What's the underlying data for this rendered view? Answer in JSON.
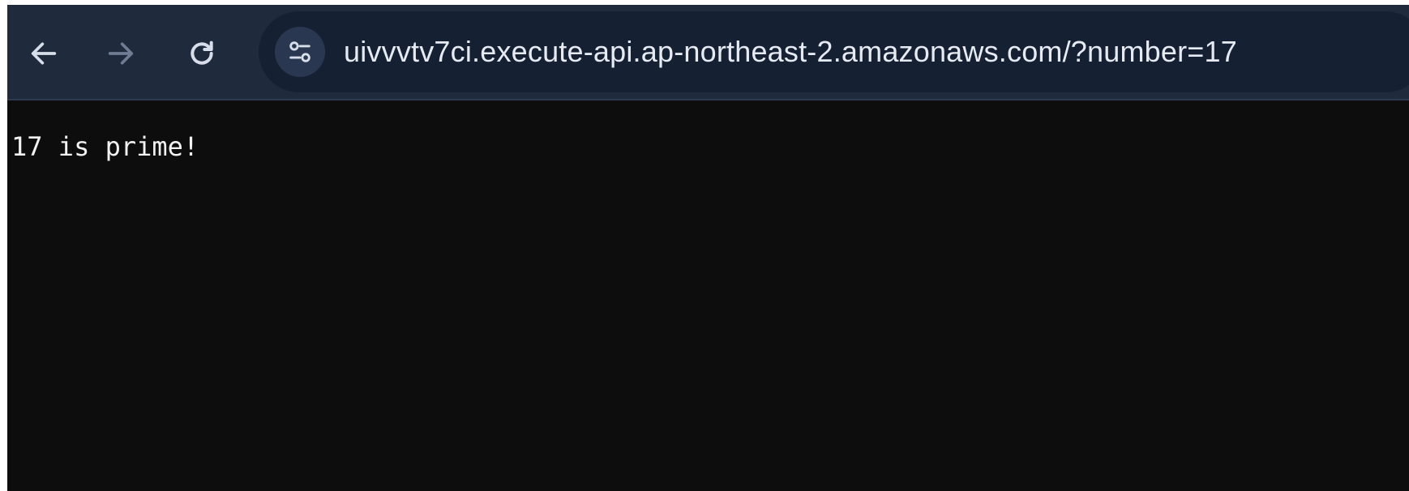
{
  "browser": {
    "toolbar": {
      "back_icon": "arrow-left-icon",
      "forward_icon": "arrow-right-icon",
      "reload_icon": "reload-icon",
      "site_info_icon": "tune-icon"
    },
    "address_bar": {
      "url": "uivvvtv7ci.execute-api.ap-northeast-2.amazonaws.com/?number=17"
    }
  },
  "page": {
    "body_text": "17 is prime!"
  },
  "colors": {
    "toolbar_bg": "#1f2a3d",
    "omnibox_bg": "#162033",
    "page_bg": "#0d0d0d",
    "text": "#f2f2f2",
    "disabled_icon": "#6f7c93",
    "icon": "#d8dee9"
  }
}
